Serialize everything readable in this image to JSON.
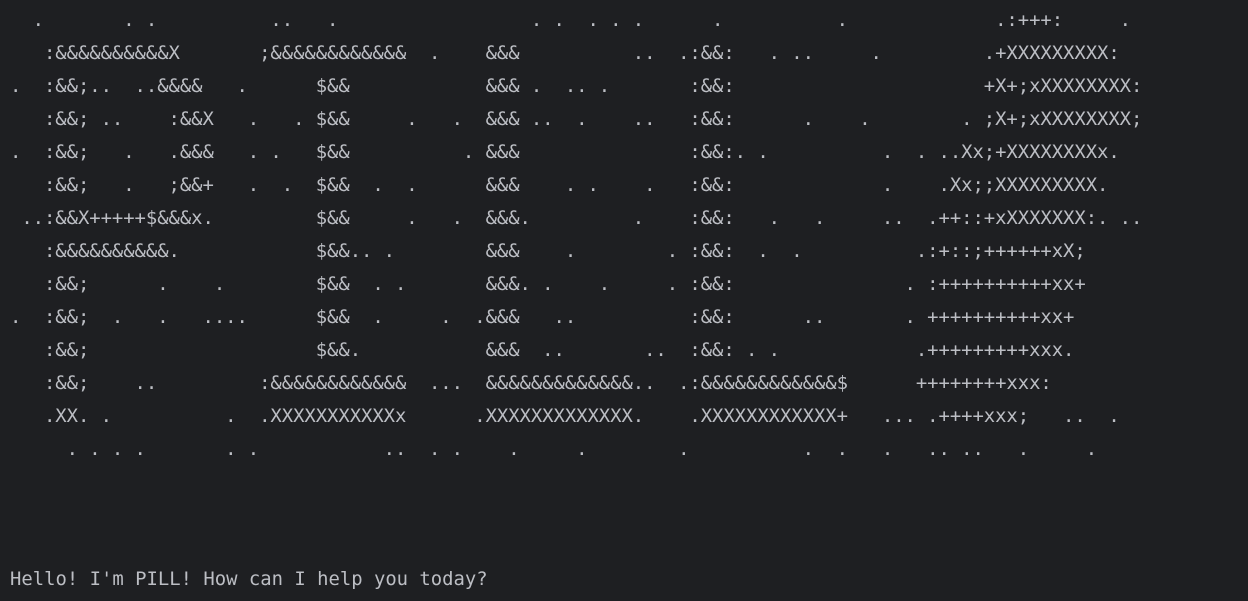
{
  "terminal": {
    "colors": {
      "background": "#1e1f22",
      "foreground": "#bcbec4"
    },
    "ascii_art": [
      "  .       . .          ..   .                 . .  . . .      .          .             .:+++:     .",
      "   :&&&&&&&&&&X       ;&&&&&&&&&&&&  .    &&&          ..  .:&&:   . ..     .         .+XXXXXXXXX:",
      ".  :&&;..  ..&&&&   .      $&&            &&& .  .. .       :&&:                      +X+;xXXXXXXXX:",
      "   :&&; ..    :&&X   .   . $&&     .   .  &&& ..  .    ..   :&&:      .    .        . ;X+;xXXXXXXXX;",
      ".  :&&;   .   .&&&   . .   $&&          . &&&               :&&:. .          .  . ..Xx;+XXXXXXXXx.",
      "   :&&;   .   ;&&+   .  .  $&&  .  .      &&&    . .    .   :&&:             .    .Xx;;XXXXXXXXX.",
      " ..:&&X+++++$&&&x.         $&&     .   .  &&&.         .    :&&:   .   .     ..  .++::+xXXXXXXX:. ..",
      "   :&&&&&&&&&&.            $&&.. .        &&&    .        . :&&:  .  .          .:+::;++++++xX;",
      "   :&&;      .    .        $&&  . .       &&&. .    .     . :&&:               . :++++++++++xx+",
      ".  :&&;  .   .   ....      $&&  .     .  .&&&   ..          :&&:      ..       . ++++++++++xx+",
      "   :&&;                    $&&.           &&&  ..       ..  :&&: . .            .+++++++++xxx.",
      "   :&&;    ..         :&&&&&&&&&&&&  ...  &&&&&&&&&&&&&..  .:&&&&&&&&&&&&$      ++++++++xxx:",
      "   .XX. .          .  .XXXXXXXXXXXx      .XXXXXXXXXXXXX.    .XXXXXXXXXXXX+   ... .++++xxx;   ..  .",
      "     . . . .       . .           ..  . .    .     .        .          .  .   .   .. ..   .     ."
    ],
    "greeting": "Hello! I'm PILL! How can I help you today?"
  }
}
